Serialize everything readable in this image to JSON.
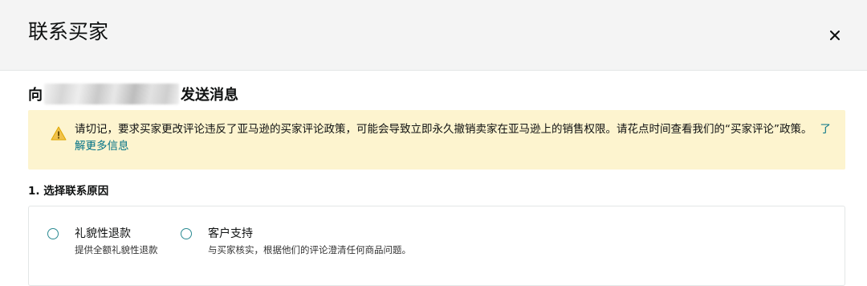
{
  "dialog": {
    "title": "联系买家",
    "close_icon": "close-icon"
  },
  "send_line": {
    "prefix": "向",
    "suffix": "发送消息"
  },
  "alert": {
    "icon": "warning-icon",
    "icon_color": "#f0c14b",
    "text": "请切记，要求买家更改评论违反了亚马逊的买家评论政策，可能会导致立即永久撤销卖家在亚马逊上的销售权限。请花点时间查看我们的“买家评论”政策。",
    "link": "了解更多信息",
    "link_color": "#007185",
    "background": "#fdf4cf"
  },
  "reason_section": {
    "title": "1. 选择联系原因",
    "options": [
      {
        "label": "礼貌性退款",
        "description": "提供全额礼貌性退款"
      },
      {
        "label": "客户支持",
        "description": "与买家核实，根据他们的评论澄清任何商品问题。"
      }
    ]
  }
}
